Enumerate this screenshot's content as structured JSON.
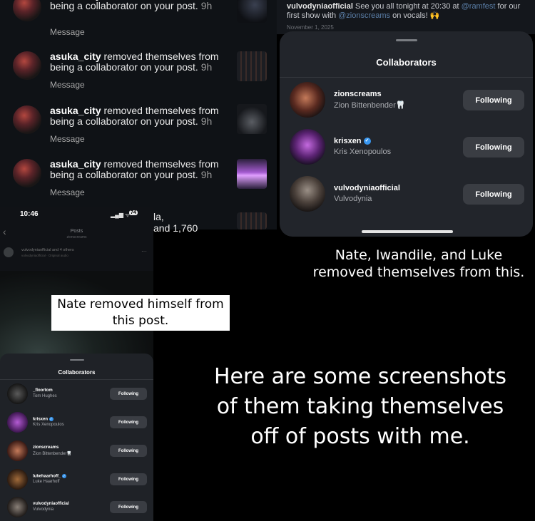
{
  "notifications": [
    {
      "username": "asuka_city",
      "text": "removed themselves from being a collaborator on your post.",
      "time": "9h",
      "action": "Message"
    },
    {
      "username": "asuka_city",
      "text": "removed themselves from being a collaborator on your post.",
      "time": "9h",
      "action": "Message"
    },
    {
      "username": "asuka_city",
      "text": "removed themselves from being a collaborator on your post.",
      "time": "9h",
      "action": "Message"
    },
    {
      "username": "asuka_city",
      "text": "removed themselves from being a collaborator on your post.",
      "time": "9h",
      "action": "Message"
    }
  ],
  "post_caption": {
    "username": "vulvodyniaofficial",
    "text_before": "See you all tonight at 20:30 at",
    "mention1": "@ramfest",
    "text_mid": "for our first show with",
    "mention2": "@zionscreams",
    "text_after": "on vocals! 🙌",
    "date": "November 1, 2025"
  },
  "sheet_big": {
    "title": "Collaborators",
    "items": [
      {
        "username": "zionscreams",
        "name": "Zion Bittenbender🦷",
        "button": "Following",
        "verified": false
      },
      {
        "username": "krisxen",
        "name": "Kris Xenopoulos",
        "button": "Following",
        "verified": true
      },
      {
        "username": "vulvodyniaofficial",
        "name": "Vulvodynia",
        "button": "Following",
        "verified": false
      }
    ]
  },
  "phone": {
    "time": "10:46",
    "battery": "74",
    "header_title": "Posts",
    "header_sub": "zionscreams",
    "post_user": "vulvodyniaofficial and 4 others",
    "post_audio": "vulvodyniaofficial · Original audio",
    "more": "···",
    "overlay_text1": "la,",
    "overlay_text2": "and 1,760"
  },
  "sheet_small": {
    "title": "Collaborators",
    "items": [
      {
        "username": "_floortom",
        "name": "Tom Hughes",
        "button": "Following",
        "verified": false
      },
      {
        "username": "krisxen",
        "name": "Kris Xenopoulos",
        "button": "Following",
        "verified": true
      },
      {
        "username": "zionscreams",
        "name": "Zion Bittenbender🦷",
        "button": "Following",
        "verified": false
      },
      {
        "username": "lukehaarhoff_",
        "name": "Luke Haarhoff",
        "button": "Following",
        "verified": true
      },
      {
        "username": "vulvodyniaofficial",
        "name": "Vulvodynia",
        "button": "Following",
        "verified": false
      }
    ]
  },
  "captions": {
    "right_top": "Nate, Iwandile, and Luke removed themselves from this.",
    "left_middle": "Nate removed himself from this post.",
    "main": "Here are some screenshots of them taking themselves off of posts with me."
  },
  "colors": {
    "background": "#000000",
    "sheet": "#22252b",
    "button": "#3a3d43",
    "verified": "#3897f0",
    "mention": "#5b7fa8"
  }
}
